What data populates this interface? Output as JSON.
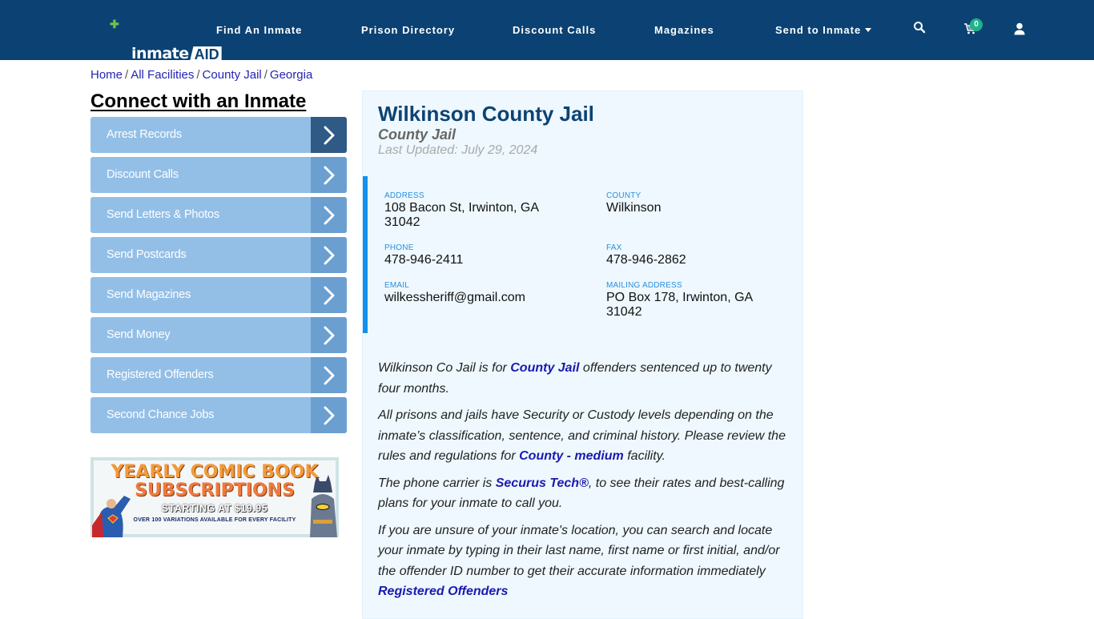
{
  "header": {
    "logo_text": "inmate",
    "logo_badge": "AID",
    "nav": [
      {
        "label": "Find An Inmate"
      },
      {
        "label": "Prison Directory"
      },
      {
        "label": "Discount Calls"
      },
      {
        "label": "Magazines"
      },
      {
        "label": "Send to Inmate",
        "has_dropdown": true
      }
    ],
    "icons": {
      "search": "search-icon",
      "cart": "cart-icon",
      "user": "user-icon"
    },
    "cart_count": "0"
  },
  "breadcrumb": [
    {
      "label": "Home"
    },
    {
      "label": "All Facilities"
    },
    {
      "label": "County Jail"
    },
    {
      "label": "Georgia"
    }
  ],
  "breadcrumb_separator": "/",
  "sidebar": {
    "title": "Connect with an Inmate",
    "items": [
      {
        "label": "Arrest Records"
      },
      {
        "label": "Discount Calls"
      },
      {
        "label": "Send Letters & Photos"
      },
      {
        "label": "Send Postcards"
      },
      {
        "label": "Send Magazines"
      },
      {
        "label": "Send Money"
      },
      {
        "label": "Registered Offenders"
      },
      {
        "label": "Second Chance Jobs"
      }
    ],
    "banner": {
      "line1": "YEARLY COMIC BOOK",
      "line2": "SUBSCRIPTIONS",
      "line3": "STARTING AT $19.95",
      "line4": "OVER 100 VARIATIONS AVAILABLE FOR EVERY FACILITY"
    }
  },
  "facility": {
    "name": "Wilkinson County Jail",
    "type": "County Jail",
    "last_updated": "Last Updated: July 29, 2024",
    "fields": {
      "address": {
        "label": "ADDRESS",
        "value": "108 Bacon St, Irwinton, GA 31042"
      },
      "county": {
        "label": "COUNTY",
        "value": "Wilkinson"
      },
      "phone": {
        "label": "PHONE",
        "value": "478-946-2411"
      },
      "fax": {
        "label": "FAX",
        "value": "478-946-2862"
      },
      "email": {
        "label": "EMAIL",
        "value": "wilkessheriff@gmail.com"
      },
      "mailing_address": {
        "label": "MAILING ADDRESS",
        "value": "PO Box 178, Irwinton, GA 31042"
      }
    },
    "description": {
      "p1_before": "Wilkinson Co Jail is for ",
      "p1_link": "County Jail",
      "p1_after": " offenders sentenced up to twenty four months.",
      "p2_before": "All prisons and jails have Security or Custody levels depending on the inmate’s classification, sentence, and criminal history. Please review the rules and regulations for ",
      "p2_link": "County - medium",
      "p2_after": " facility.",
      "p3_before": "The phone carrier is ",
      "p3_link": "Securus Tech®",
      "p3_after": ", to see their rates and best-calling plans for your inmate to call you.",
      "p4_text": "If you are unsure of your inmate's location, you can search and locate your inmate by typing in their last name, first name or first initial, and/or the offender ID number to get their accurate information immediately",
      "p4_link": "Registered Offenders"
    }
  },
  "colors": {
    "header_bg": "#0b4273",
    "accent_blue": "#1391ee",
    "menu_item_bg": "#93bfe7",
    "menu_arrow_bg": "#6a9fd0",
    "menu_arrow_active_bg": "#2f5a86",
    "cart_badge": "#1fb28a",
    "link": "#1a1ab0"
  }
}
